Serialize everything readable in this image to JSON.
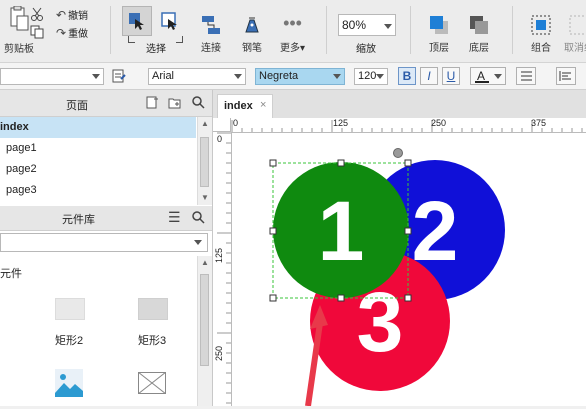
{
  "toolbar": {
    "paste_label": "剪贴板",
    "undo_label": "撤销",
    "redo_label": "重做",
    "select_label": "选择",
    "connect_label": "连接",
    "pen_label": "钢笔",
    "more_label": "更多▾",
    "zoom_value": "80%",
    "zoom_label": "缩放",
    "front_label": "顶层",
    "back_label": "底层",
    "group_label": "组合",
    "ungroup_label": "取消组"
  },
  "format_bar": {
    "font_family": "Arial",
    "font_style": "Negreta",
    "font_size": "120",
    "bold": "B",
    "italic": "I",
    "underline": "U",
    "text_color": "A"
  },
  "pages_panel": {
    "title": "页面",
    "items": [
      {
        "label": "index"
      },
      {
        "label": "page1"
      },
      {
        "label": "page2"
      },
      {
        "label": "page3"
      }
    ]
  },
  "library_panel": {
    "title": "元件库",
    "section_label": "元件",
    "widgets": [
      {
        "label": "矩形2"
      },
      {
        "label": "矩形3"
      }
    ]
  },
  "canvas": {
    "tab_label": "index",
    "tab_close": "×",
    "ruler_h_ticks": [
      "0",
      "125",
      "250",
      "375"
    ],
    "ruler_v_ticks": [
      "0",
      "125",
      "250"
    ],
    "shapes": [
      {
        "label": "1",
        "color": "#0f8a0f"
      },
      {
        "label": "2",
        "color": "#1010d8"
      },
      {
        "label": "3",
        "color": "#f0083a"
      }
    ],
    "arrow_color": "#e8394a"
  }
}
